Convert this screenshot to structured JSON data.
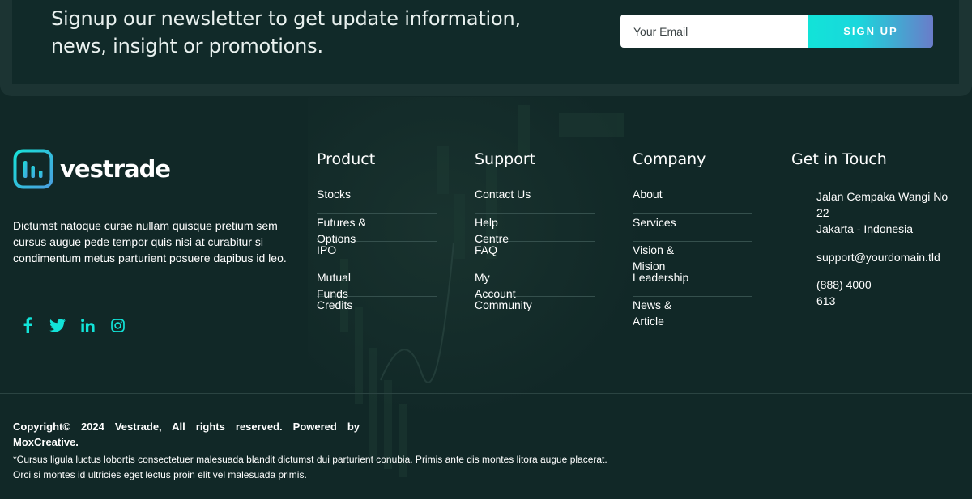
{
  "newsletter": {
    "text_line1": "Signup our newsletter to get update information,",
    "text_line2": "news, insight or promotions.",
    "email_placeholder": "Your Email",
    "button_label": "SIGN UP"
  },
  "brand": {
    "name": "vestrade",
    "description": "Dictumst natoque curae nullam quisque pretium sem cursus augue pede tempor quis nisi at curabitur si condimentum metus parturient posuere dapibus id leo.",
    "accent_color": "#12e3d8"
  },
  "social": [
    "facebook-icon",
    "twitter-icon",
    "linkedin-icon",
    "instagram-icon"
  ],
  "columns": [
    {
      "title": "Product",
      "links": [
        "Stocks",
        "Futures & Options",
        "IPO",
        "Mutual Funds",
        "Credits"
      ]
    },
    {
      "title": "Support",
      "links": [
        "Contact Us",
        "Help Centre",
        "FAQ",
        "My Account",
        "Community"
      ]
    },
    {
      "title": "Company",
      "links": [
        "About",
        "Services",
        "Vision & Mision",
        "Leadership",
        "News & Article"
      ]
    }
  ],
  "contact": {
    "title": "Get in Touch",
    "address_line1": "Jalan Cempaka Wangi No 22",
    "address_line2": "Jakarta - Indonesia",
    "email": "support@yourdomain.tld",
    "phone": "(888) 4000 613"
  },
  "footer": {
    "copyright": "Copyright© 2024 Vestrade, All rights reserved. Powered by MoxCreative.",
    "disclaimer_line1": "*Cursus ligula luctus lobortis consectetuer malesuada blandit dictumst dui parturient conubia. Primis ante dis montes litora augue placerat.",
    "disclaimer_line2": "Orci si montes id ultricies eget lectus proin elit vel malesuada primis."
  }
}
